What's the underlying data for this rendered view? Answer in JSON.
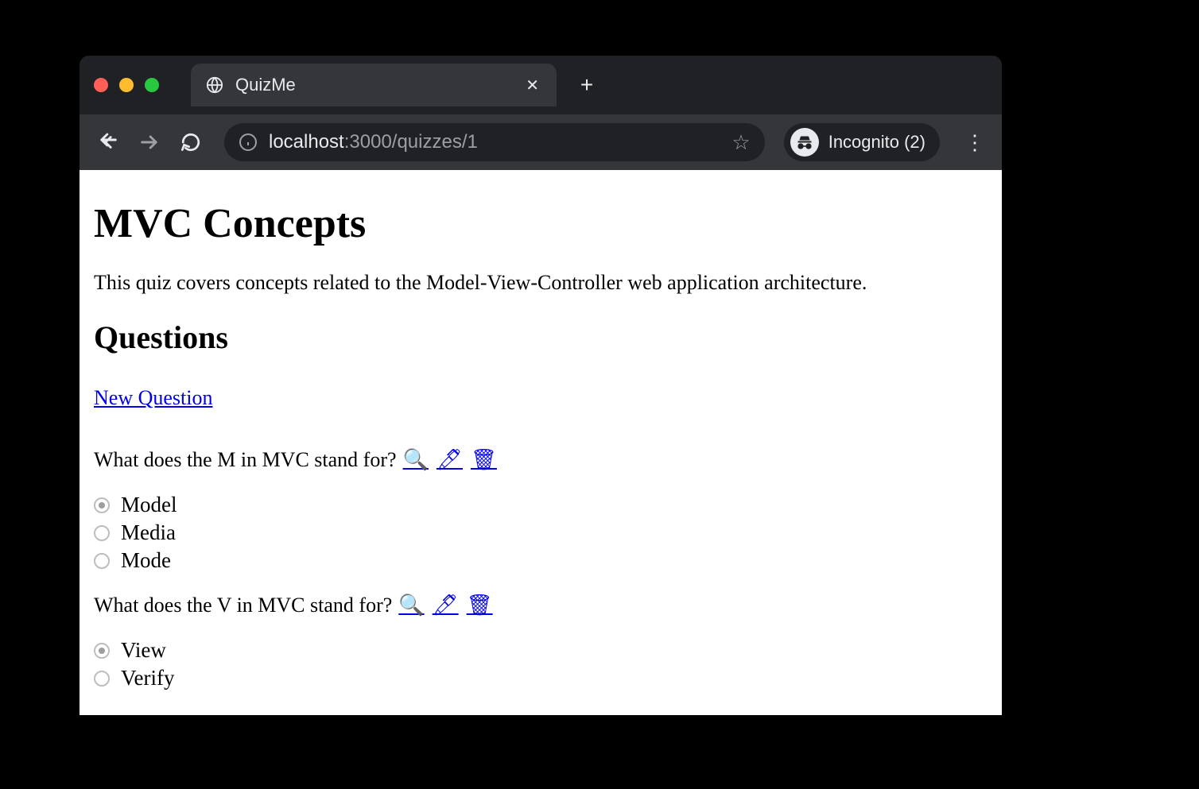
{
  "browser": {
    "tab_title": "QuizMe",
    "url_host": "localhost",
    "url_port_path": ":3000/quizzes/1",
    "incognito_label": "Incognito (2)"
  },
  "page": {
    "title": "MVC Concepts",
    "description": "This quiz covers concepts related to the Model-View-Controller web application architecture.",
    "questions_heading": "Questions",
    "new_question_label": "New Question",
    "icons": {
      "view": "🔍",
      "edit": "🖊",
      "delete": "🗑"
    },
    "questions": [
      {
        "text": "What does the M in MVC stand for?",
        "options": [
          {
            "label": "Model",
            "checked": true
          },
          {
            "label": "Media",
            "checked": false
          },
          {
            "label": "Mode",
            "checked": false
          }
        ]
      },
      {
        "text": "What does the V in MVC stand for?",
        "options": [
          {
            "label": "View",
            "checked": true
          },
          {
            "label": "Verify",
            "checked": false
          }
        ]
      }
    ]
  }
}
